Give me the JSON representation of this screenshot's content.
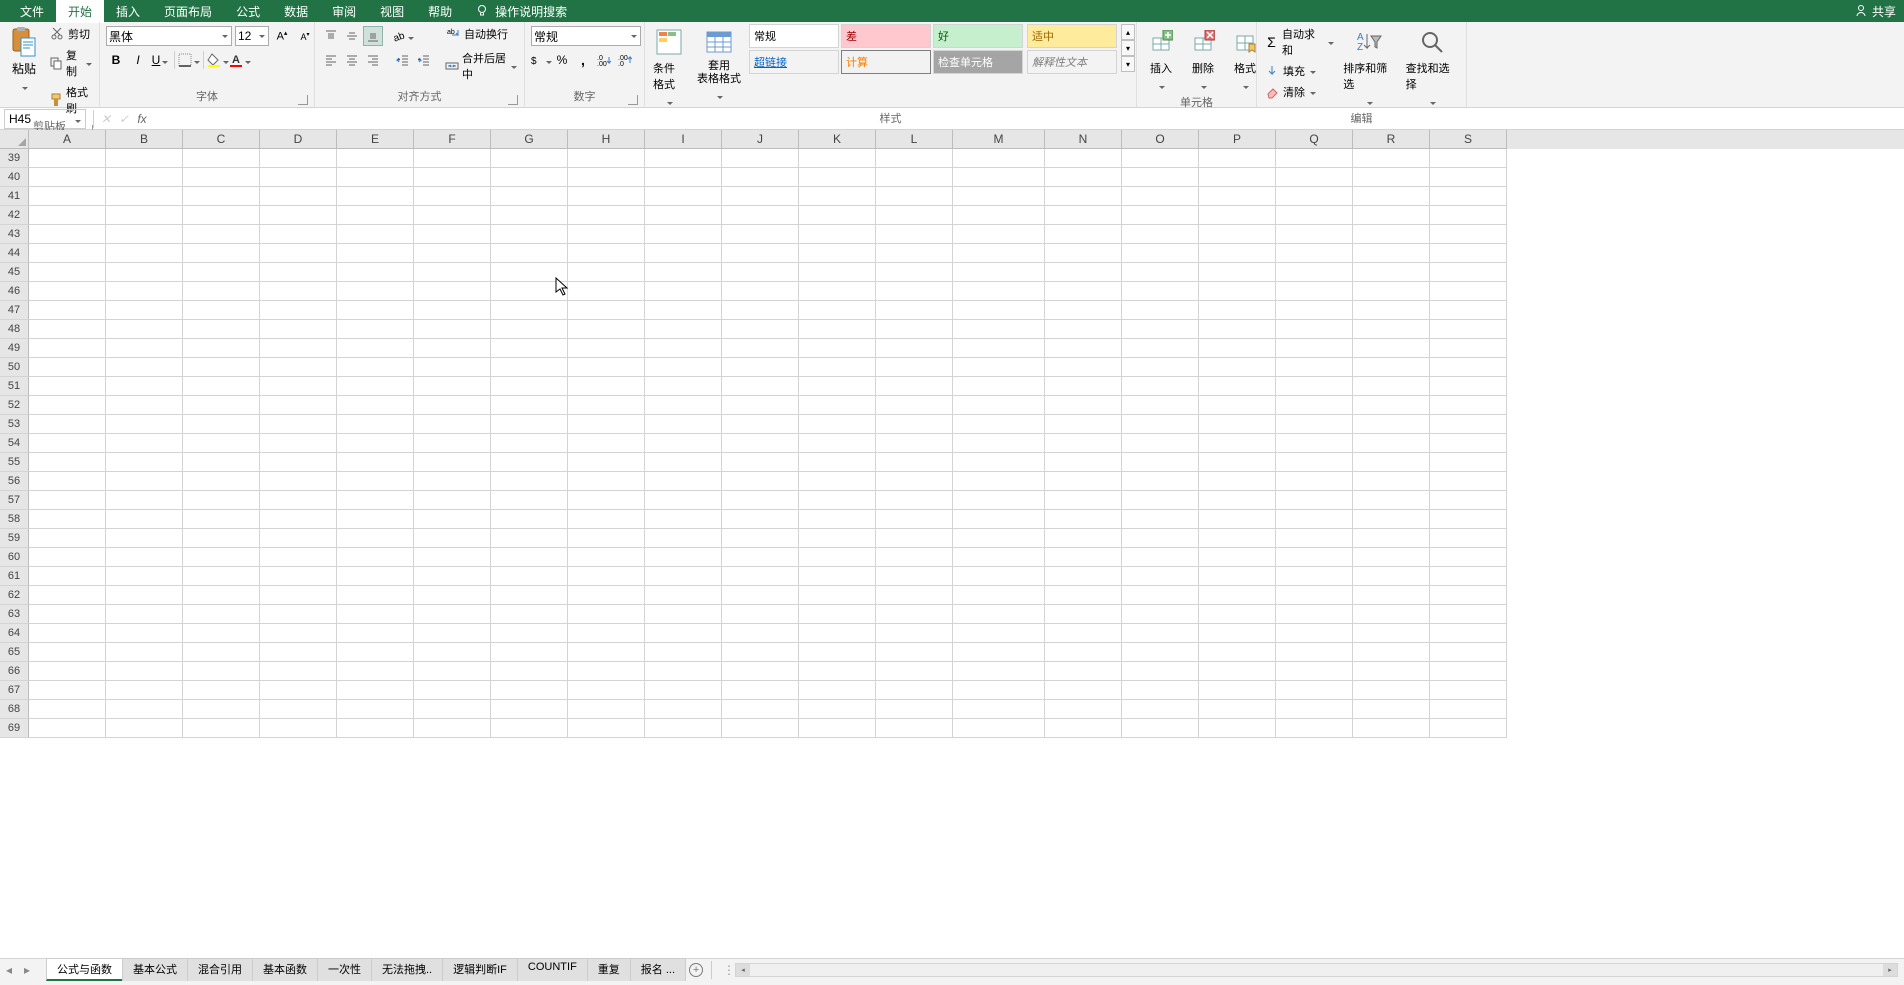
{
  "tabs": {
    "file": "文件",
    "home": "开始",
    "insert": "插入",
    "pageLayout": "页面布局",
    "formulas": "公式",
    "data": "数据",
    "review": "审阅",
    "view": "视图",
    "help": "帮助"
  },
  "actionSearch": "操作说明搜索",
  "share": "共享",
  "clipboard": {
    "paste": "粘贴",
    "cut": "剪切",
    "copy": "复制",
    "formatPainter": "格式刷",
    "label": "剪贴板"
  },
  "font": {
    "name": "黑体",
    "size": "12",
    "label": "字体"
  },
  "alignment": {
    "wrap": "自动换行",
    "merge": "合并后居中",
    "label": "对齐方式"
  },
  "number": {
    "format": "常规",
    "label": "数字"
  },
  "styles": {
    "conditional": "条件格式",
    "tableFormat": "套用\n表格格式",
    "normal": "常规",
    "bad": "差",
    "good": "好",
    "neutral": "适中",
    "hyperlink": "超链接",
    "calc": "计算",
    "check": "检查单元格",
    "explain": "解释性文本",
    "label": "样式"
  },
  "cells": {
    "insert": "插入",
    "delete": "删除",
    "format": "格式",
    "label": "单元格"
  },
  "editing": {
    "autosum": "自动求和",
    "fill": "填充",
    "clear": "清除",
    "sortFilter": "排序和筛选",
    "findSelect": "查找和选择",
    "label": "编辑"
  },
  "nameBox": "H45",
  "formulaValue": "",
  "columns": [
    "A",
    "B",
    "C",
    "D",
    "E",
    "F",
    "G",
    "H",
    "I",
    "J",
    "K",
    "L",
    "M",
    "N",
    "O",
    "P",
    "Q",
    "R",
    "S"
  ],
  "colWidths": {
    "A": 77,
    "B": 77,
    "C": 77,
    "D": 77,
    "E": 77,
    "F": 77,
    "G": 77,
    "H": 77,
    "I": 77,
    "J": 77,
    "K": 77,
    "L": 77,
    "M": 92,
    "N": 77,
    "O": 77,
    "P": 77,
    "Q": 77,
    "R": 77,
    "S": 77
  },
  "rowStart": 39,
  "rowEnd": 69,
  "sheetTabs": [
    {
      "name": "公式与函数",
      "active": true
    },
    {
      "name": "基本公式",
      "active": false
    },
    {
      "name": "混合引用",
      "active": false
    },
    {
      "name": "基本函数",
      "active": false
    },
    {
      "name": "一次性",
      "active": false
    },
    {
      "name": "无法拖拽..",
      "active": false
    },
    {
      "name": "逻辑判断IF",
      "active": false
    },
    {
      "name": "COUNTIF",
      "active": false
    },
    {
      "name": "重复",
      "active": false
    },
    {
      "name": "报名 ...",
      "active": false
    }
  ]
}
